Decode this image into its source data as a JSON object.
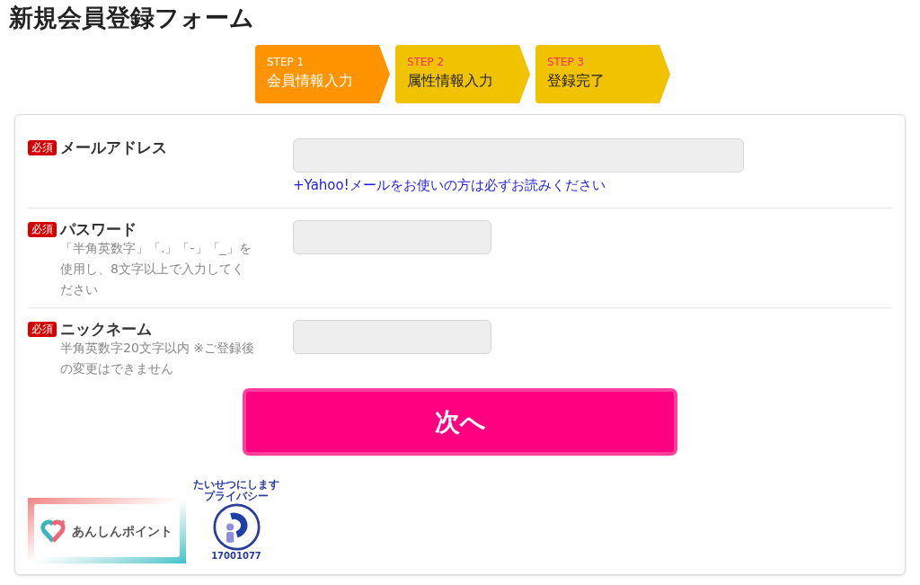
{
  "page_title": "新規会員登録フォーム",
  "steps": [
    {
      "step": "STEP 1",
      "label": "会員情報入力",
      "selected": true
    },
    {
      "step": "STEP 2",
      "label": "属性情報入力",
      "selected": false
    },
    {
      "step": "STEP 3",
      "label": "登録完了",
      "selected": false
    }
  ],
  "form": {
    "fields": [
      {
        "kind": "email",
        "badge": "必須",
        "label": "メールアドレス",
        "link": "+Yahoo!メールをお使いの方は必ずお読みください"
      },
      {
        "kind": "password",
        "badge": "必須",
        "label": "パスワード",
        "hint": "「半角英数字」「.」「-」「_」を使用し、8文字以上で入力してください"
      },
      {
        "kind": "text",
        "badge": "必須",
        "label": "ニックネーム",
        "hint": "半角英数字20文字以内 ※ご登録後の変更はできません"
      }
    ],
    "submit_button": "次へ",
    "logos": [
      {
        "kind": "anshin",
        "text": "あんしんポイント"
      },
      {
        "kind": "privacy",
        "tagline": "たいせつにしますプライバシー",
        "number": "17001077"
      }
    ]
  }
}
